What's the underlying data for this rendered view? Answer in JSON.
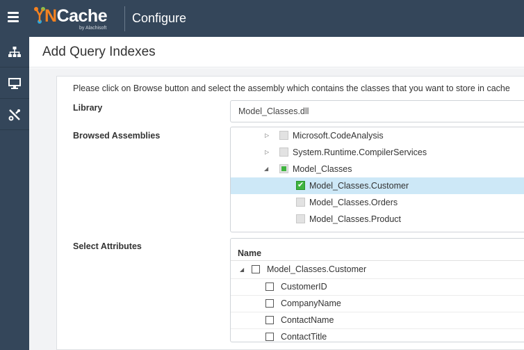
{
  "app": {
    "logo_text_n": "N",
    "logo_text_rest": "Cache",
    "logo_sub": "by Alachisoft",
    "title": "Configure"
  },
  "sidebar": {
    "items": [
      {
        "icon": "topology-icon"
      },
      {
        "icon": "monitor-icon"
      },
      {
        "icon": "tools-icon"
      }
    ]
  },
  "page": {
    "title": "Add Query Indexes",
    "instruction": "Please click on Browse button and select the assembly which contains the classes that you want to store in cache"
  },
  "library": {
    "label": "Library",
    "value": "Model_Classes.dll"
  },
  "assemblies": {
    "label": "Browsed Assemblies",
    "items": [
      {
        "label": "Microsoft.CodeAnalysis",
        "state": "unchecked",
        "expander": "▷"
      },
      {
        "label": "System.Runtime.CompilerServices",
        "state": "unchecked",
        "expander": "▷"
      },
      {
        "label": "Model_Classes",
        "state": "partial",
        "expander": "◢"
      },
      {
        "label": "Model_Classes.Customer",
        "state": "checked",
        "selected": true
      },
      {
        "label": "Model_Classes.Orders",
        "state": "unchecked"
      },
      {
        "label": "Model_Classes.Product",
        "state": "unchecked"
      }
    ]
  },
  "attributes": {
    "label": "Select Attributes",
    "column_header": "Name",
    "parent": {
      "label": "Model_Classes.Customer",
      "expander": "◢"
    },
    "children": [
      {
        "label": "CustomerID"
      },
      {
        "label": "CompanyName"
      },
      {
        "label": "ContactName"
      },
      {
        "label": "ContactTitle"
      }
    ]
  },
  "colors": {
    "nav": "#34465a",
    "accent_orange": "#f58220",
    "check_green": "#3fb43f",
    "selection": "#cde8f7"
  }
}
